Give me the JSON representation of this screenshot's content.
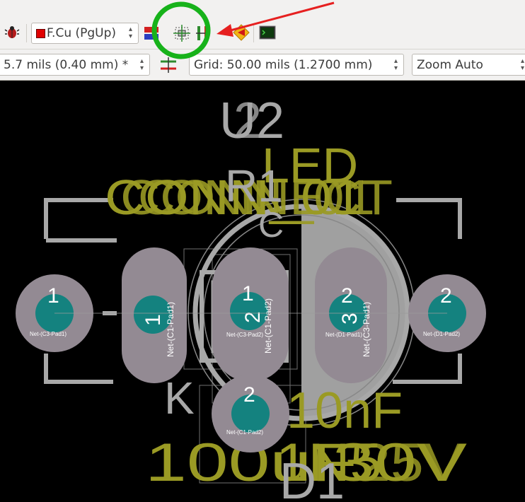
{
  "toolbar": {
    "layer_select": {
      "value": "F.Cu (PgUp)",
      "color": "#e00000"
    },
    "track_width_select": {
      "value": "5.7 mils (0.40 mm) *"
    },
    "grid_select": {
      "value": "Grid: 50.00 mils (1.2700 mm)"
    },
    "zoom_select": {
      "value": "Zoom Auto"
    },
    "icons": [
      "drc-bug-icon",
      "layer-pair-icon",
      "autoplace-footprints-icon",
      "autoroute-icon",
      "highlight-net-icon",
      "scripting-console-icon",
      "track-via-autosize-icon"
    ]
  },
  "annotations": {
    "circle_color": "#17b21a",
    "arrow_color": "#e62020"
  },
  "board": {
    "colors": {
      "background": "#000000",
      "silk": "#a8a8a8",
      "fab": "#9a9a24",
      "pad": "#938a93",
      "drill": "#14827f",
      "pad_text": "#ffffff",
      "courtyard": "#7a7a7a"
    },
    "silk_refs": [
      "U2",
      "R1",
      "C",
      "C1",
      "K",
      "D1"
    ],
    "fab_values": [
      "LED",
      "CONN_01",
      "CONN_01",
      "CONNECT",
      "10nF",
      "100uF",
      "1N5",
      "30V",
      "25V",
      "LED"
    ],
    "pads": [
      {
        "number": "1",
        "net": "Net-(C3-Pad1)"
      },
      {
        "number": "1",
        "net": "Net-(C1-Pad1)"
      },
      {
        "number": "2",
        "net": "Net-(C3-Pad2)"
      },
      {
        "number": "1",
        "net": "Net-(C1-Pad2)"
      },
      {
        "number": "2",
        "net": "Net-(D1-Pad1)"
      },
      {
        "number": "3",
        "net": "Net-(C3-Pad1)"
      },
      {
        "number": "2",
        "net": "Net-(D1-Pad2)"
      },
      {
        "number": "2",
        "net": "Net-(C1-Pad2)"
      }
    ]
  }
}
